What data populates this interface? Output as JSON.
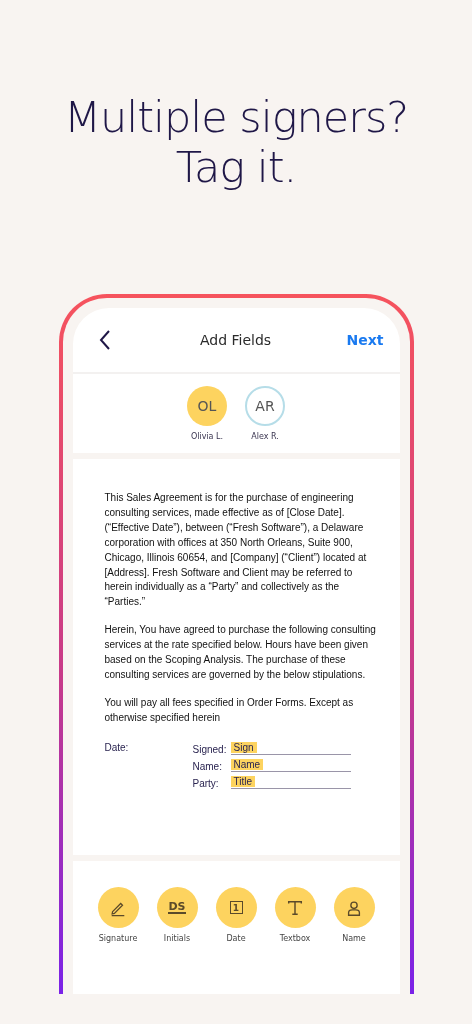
{
  "headline": [
    "Multiple signers?",
    "Tag it."
  ],
  "nav": {
    "title": "Add Fields",
    "action": "Next"
  },
  "signers": [
    {
      "initials": "OL",
      "name": "Olivia L.",
      "selected": true
    },
    {
      "initials": "AR",
      "name": "Alex R.",
      "selected": false
    }
  ],
  "document": {
    "paragraphs": [
      "This Sales Agreement is for the purchase of engineering consulting services, made effective as of [Close Date]. (“Effective Date”), between (“Fresh Software”), a Delaware corporation with offices at 350 North Orleans, Suite 900, Chicago, Illinois 60654, and [Company] (“Client”) located at [Address]. Fresh Software and Client may be referred to herein individually as a “Party” and collectively as the “Parties.”",
      "Herein, You have agreed to purchase the following consulting services at the rate specified below. Hours have been given based on the Scoping Analysis. The purchase of these consulting services are governed by the below stipulations.",
      "You will pay all fees specified in Order Forms. Except as otherwise specified herein"
    ],
    "date_label": "Date:",
    "fields": [
      {
        "label": "Signed:",
        "tag": "Sign"
      },
      {
        "label": "Name:",
        "tag": "Name"
      },
      {
        "label": "Party:",
        "tag": "Title"
      }
    ]
  },
  "tools": [
    {
      "kind": "signature",
      "label": "Signature"
    },
    {
      "kind": "initials",
      "label": "Initials",
      "icon_text": "DS"
    },
    {
      "kind": "date",
      "label": "Date",
      "icon_text": "1"
    },
    {
      "kind": "textbox",
      "label": "Textbox"
    },
    {
      "kind": "name",
      "label": "Name"
    }
  ]
}
